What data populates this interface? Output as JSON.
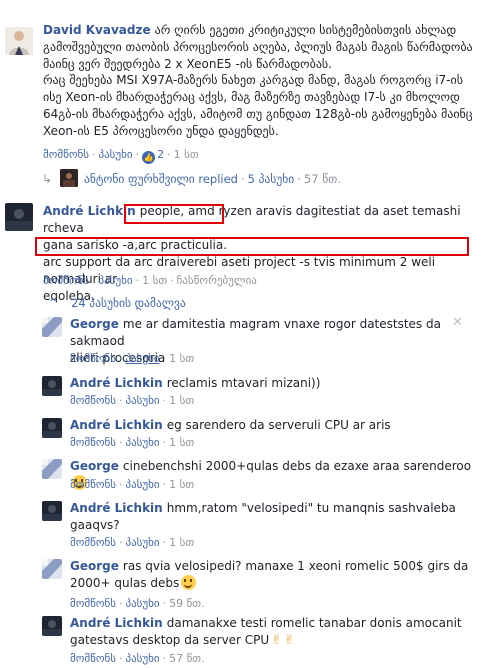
{
  "c1": {
    "author": "David Kvavadze",
    "text_line1": "არ ღირს ეგეთი კრიტიკული სისტემებისთვის ახლად",
    "text_rest": "გამოშვებული თაობის პროცესორის აღება, პლიუს მაგას მაგის წარმადობა მაინც ვერ შეედრება 2 x XeonE5 -ის წარმადობას.",
    "text_para2": "რაც შეეხება MSI X97A-მაზერს ნახეთ კარგად მანდ, მაგას როგორც i7-ის ისე Xeon-ის მხარდაჭერაც აქვს, მაგ მაზერზე თავზებად I7-ს კი მხოლოდ 64გბ-ის მხარდაჭერა აქვს, ამიტომ თუ გინდათ 128გბ-ის გამოყენება მაინც Xeon-ის E5 პროცესორი უნდა დაყენდეს.",
    "like": "მომწონს",
    "reply": "პასუხი",
    "likes_count": "2",
    "time": "1 სთ"
  },
  "c1_reply_summary": {
    "name": "ანტონი ფურხშვილი",
    "verb": "replied",
    "count": "5 პასუხი",
    "time": "57 წთ."
  },
  "c2": {
    "author": "André Lichkin",
    "line1_pre": "",
    "line1_box": "people, amd ryzen",
    "line1_post": " aravis dagitestiat da aset temashi rcheva",
    "line2": "gana sarisko -a,arc practiculia.",
    "line3": "arc support da arc draiverebi aseti project -s tvis minimum 2 weli normaluri ar",
    "line4": "eqoleba.",
    "like": "მომწონს",
    "reply": "პასუხი",
    "time": "1 სთ",
    "edited": "ჩასწორებულია"
  },
  "hide_replies": "24 პასუხის დამალვა",
  "replies": [
    {
      "author": "George",
      "text1": "me ar damitestia magram vnaxe rogor dateststes da sakmaod",
      "text2": "zlieri procesoria",
      "like": "მომწონს",
      "reply": "პასუხი",
      "time": "1 სთ"
    },
    {
      "author": "André Lichkin",
      "text1": "reclamis mtavari mizani))",
      "like": "მომწონს",
      "reply": "პასუხი",
      "time": "1 სთ"
    },
    {
      "author": "André Lichkin",
      "text1": "eg sarendero da serveruli CPU ar aris",
      "like": "მომწონს",
      "reply": "პასუხი",
      "time": "1 სთ"
    },
    {
      "author": "George",
      "text1": "cinebenchshi 2000+qulas debs da ezaxe araa sarenderoo",
      "like": "მომწონს",
      "reply": "პასუხი",
      "time": "1 სთ"
    },
    {
      "author": "André Lichkin",
      "text1": "hmm,ratom \"velosipedi\" tu manqnis sashvaleba",
      "text2": "gaaqvs?",
      "like": "მომწონს",
      "reply": "პასუხი",
      "time": "1 სთ"
    },
    {
      "author": "George",
      "text1": "ras qvia velosipedi? manaxe 1 xeoni romelic 500$ girs da",
      "text2": "2000+ qulas debs",
      "like": "მომწონს",
      "reply": "პასუხი",
      "time": "59 წთ."
    },
    {
      "author": "André Lichkin",
      "text1": "damanakxe testi romelic tanabar donis amocanit",
      "text2": "gatestavs desktop da server CPU",
      "like": "მომწონს",
      "reply": "პასუხი",
      "time": "57 წთ."
    }
  ],
  "dot": "·",
  "colors": {
    "link": "#365899",
    "action": "#4267b2",
    "meta": "#90949c",
    "highlight_box": "#e0000b"
  }
}
